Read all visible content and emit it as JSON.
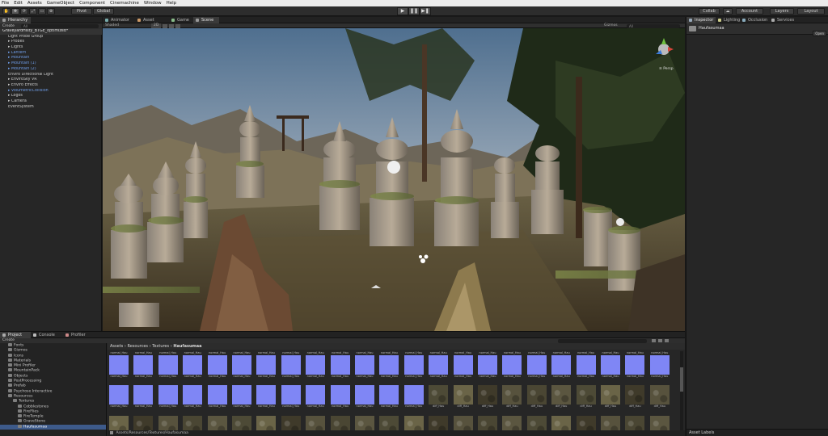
{
  "menu": [
    "File",
    "Edit",
    "Assets",
    "GameObject",
    "Component",
    "Cinemachine",
    "Window",
    "Help"
  ],
  "toolbar": {
    "pivot_label": "Pivot",
    "global_label": "Global",
    "collab_label": "Collab",
    "account_label": "Account",
    "layers_label": "Layers",
    "layout_label": "Layout",
    "play_icon": "▶",
    "pause_icon": "❚❚",
    "step_icon": "▶❚"
  },
  "hierarchy": {
    "tab": "Hierarchy",
    "create": "Create",
    "search_placeholder": "All",
    "scene_name": "GraveyardHIsty_BTGE_optimized*",
    "items": [
      {
        "label": "Light Probe Group",
        "style": "normal"
      },
      {
        "label": "▸ Probes",
        "style": "normal"
      },
      {
        "label": "▸ Lights",
        "style": "normal"
      },
      {
        "label": "▸ Lantern",
        "style": "blue"
      },
      {
        "label": "▸ Mountain",
        "style": "blue"
      },
      {
        "label": "▸ Mountain (1)",
        "style": "blue"
      },
      {
        "label": "▸ Mountain (2)",
        "style": "blue"
      },
      {
        "label": "Enviro Directional Light",
        "style": "normal"
      },
      {
        "label": "▸ EnviroSky VR",
        "style": "normal"
      },
      {
        "label": "▸ Enviro Effects",
        "style": "normal"
      },
      {
        "label": "▸ VolumetricCollision",
        "style": "blue"
      },
      {
        "label": "▸ Logos",
        "style": "normal"
      },
      {
        "label": "▸ Camera",
        "style": "normal"
      },
      {
        "label": "EventSystem",
        "style": "normal"
      }
    ]
  },
  "scene_tabs": [
    "Animator",
    "Asset Store",
    "Game",
    "Scene"
  ],
  "scene_bar": {
    "shading": "Shaded",
    "mode": "2D",
    "gizmos": "Gizmos",
    "search": "All"
  },
  "scene_gizmo": {
    "persp_label": "≡ Persp"
  },
  "inspector": {
    "tabs": [
      "Inspector",
      "Lighting",
      "Occlusion",
      "Services"
    ],
    "object_name": "Haufasumaa",
    "open_label": "Open",
    "footer": "Asset Labels"
  },
  "project": {
    "tabs": [
      "Project",
      "Console",
      "Profiler"
    ],
    "create": "Create",
    "tree": [
      {
        "label": "Fonts",
        "depth": 1,
        "sel": false
      },
      {
        "label": "Gizmos",
        "depth": 1,
        "sel": false
      },
      {
        "label": "Icons",
        "depth": 1,
        "sel": false
      },
      {
        "label": "Materials",
        "depth": 1,
        "sel": false
      },
      {
        "label": "Mini Profiler",
        "depth": 1,
        "sel": false
      },
      {
        "label": "MountainPack",
        "depth": 1,
        "sel": false
      },
      {
        "label": "Objects",
        "depth": 1,
        "sel": false
      },
      {
        "label": "PostProcessing",
        "depth": 1,
        "sel": false
      },
      {
        "label": "Prefab",
        "depth": 1,
        "sel": false
      },
      {
        "label": "Psychose Interactive",
        "depth": 1,
        "sel": false
      },
      {
        "label": "Resources",
        "depth": 1,
        "sel": false
      },
      {
        "label": "Textures",
        "depth": 2,
        "sel": false
      },
      {
        "label": "Cobblestones",
        "depth": 3,
        "sel": false
      },
      {
        "label": "FireFlies",
        "depth": 3,
        "sel": false
      },
      {
        "label": "FireTemple",
        "depth": 3,
        "sel": false
      },
      {
        "label": "GraveStone",
        "depth": 3,
        "sel": false
      },
      {
        "label": "Haufasumaa",
        "depth": 3,
        "sel": true
      }
    ],
    "breadcrumb": [
      "Assets",
      "Resources",
      "Textures",
      "Haufasumaa"
    ],
    "path": "Assets/Resources/Textures/Haufasumaa",
    "row1_label": "normal_Hau",
    "row2_normal_label": "normal_Hau",
    "row2_diffuse_label": "diff_Hau",
    "row3_label": "text_Hau",
    "colors": {
      "normal": "#7f86f5",
      "ground": "#5b5640"
    }
  }
}
